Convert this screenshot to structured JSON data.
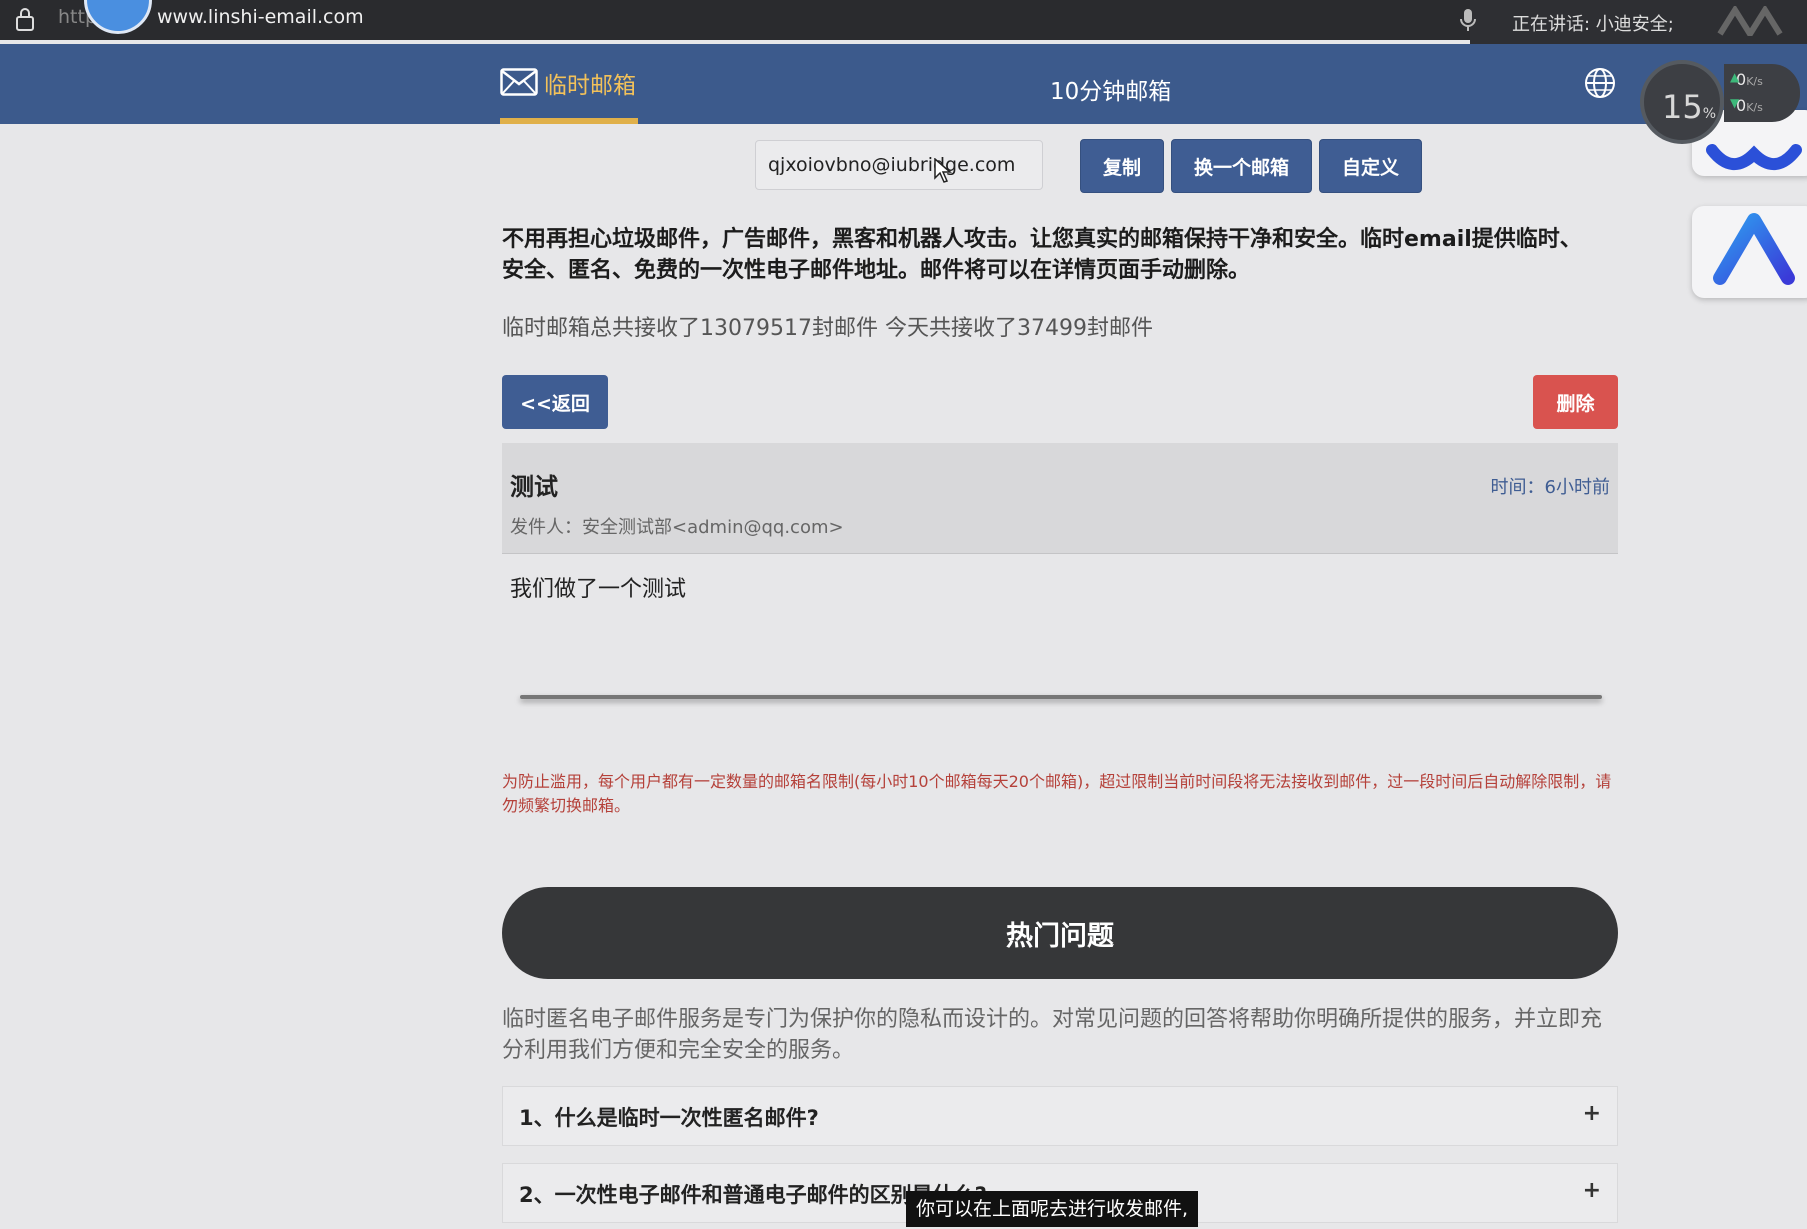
{
  "browser": {
    "url_scheme": "http",
    "url_rest": "www.linshi-email.com",
    "speaking_status": "正在讲话: 小迪安全;"
  },
  "nav": {
    "active_tab": "临时邮箱",
    "tab2": "10分钟邮箱"
  },
  "speed": {
    "percent": "15",
    "percent_unit": "%",
    "up": "0",
    "down": "0",
    "unit": "K/s"
  },
  "mailbox": {
    "address": "qjxoiovbno@iubridge.com",
    "copy_label": "复制",
    "change_label": "换一个邮箱",
    "custom_label": "自定义"
  },
  "intro": {
    "text": "不用再担心垃圾邮件，广告邮件，黑客和机器人攻击。让您真实的邮箱保持干净和安全。临时email提供临时、安全、匿名、免费的一次性电子邮件地址。邮件将可以在详情页面手动删除。",
    "stats": "临时邮箱总共接收了13079517封邮件 今天共接收了37499封邮件"
  },
  "actions": {
    "back_label": "<<返回",
    "delete_label": "删除"
  },
  "mail": {
    "subject": "测试",
    "time": "时间：6小时前",
    "from": "发件人：安全测试部<admin@qq.com>",
    "body": "我们做了一个测试"
  },
  "warning": "为防止滥用，每个用户都有一定数量的邮箱名限制(每小时10个邮箱每天20个邮箱)，超过限制当前时间段将无法接收到邮件，过一段时间后自动解除限制，请勿频繁切换邮箱。",
  "faq": {
    "title": "热门问题",
    "intro": "临时匿名电子邮件服务是专门为保护你的隐私而设计的。对常见问题的回答将帮助你明确所提供的服务，并立即充分利用我们方便和完全安全的服务。",
    "items": [
      {
        "question": "1、什么是临时一次性匿名邮件?",
        "toggle": "+"
      },
      {
        "question": "2、一次性电子邮件和普通电子邮件的区别是什么?",
        "toggle": "+"
      }
    ]
  },
  "subtitle": "你可以在上面呢去进行收发邮件,",
  "colors": {
    "nav_bg": "#3c5a8c",
    "accent": "#f2c15a",
    "button_blue": "#3f5d93",
    "danger": "#d9534f",
    "warning_text": "#b5413a"
  }
}
